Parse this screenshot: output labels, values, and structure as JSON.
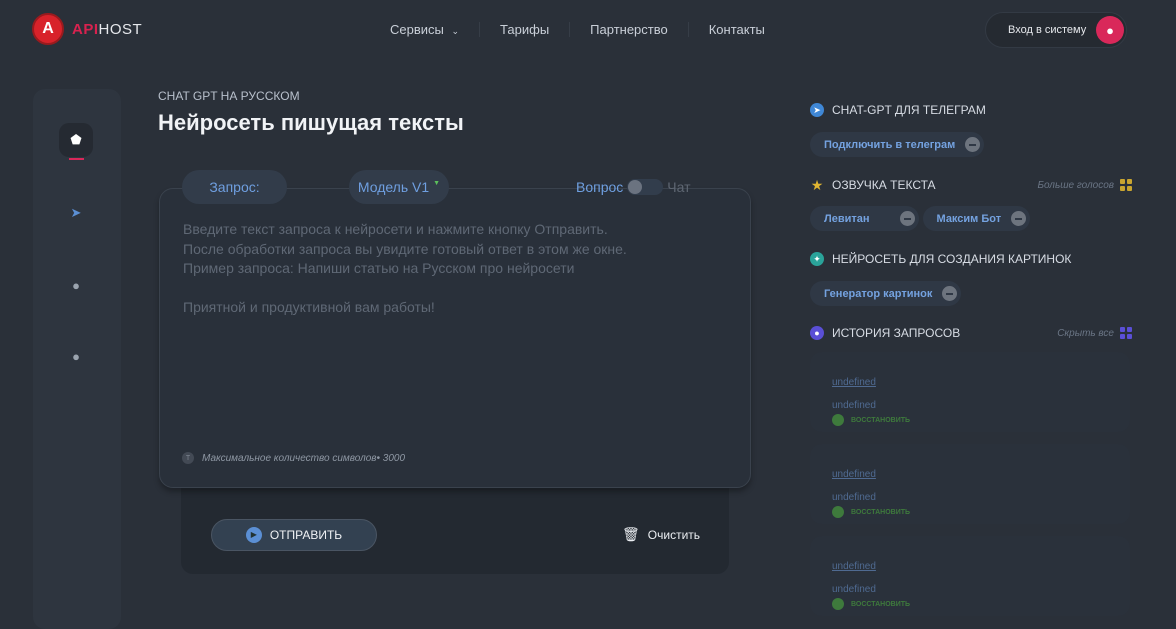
{
  "header": {
    "logo_api": "API",
    "logo_host": "HOST",
    "logo_letter": "A",
    "nav": [
      "Сервисы",
      "Тарифы",
      "Партнерство",
      "Контакты"
    ],
    "login": "Вход в систему"
  },
  "main": {
    "subtitle": "CHAT GPT НА РУССКОМ",
    "title": "Нейросеть пишущая тексты",
    "tab_request": "Запрос:",
    "tab_model": "Модель V1",
    "toggle_left": "Вопрос",
    "toggle_right": "Чат",
    "placeholder": [
      "Введите текст запроса к нейросети и нажмите кнопку Отправить.",
      "После обработки запроса вы увидите готовый ответ в этом же окне.",
      "Пример запроса: Напиши статью на Русском про нейросети",
      "",
      "Приятной и продуктивной вам работы!"
    ],
    "max_chars": "Максимальное количество символов• 3000",
    "send": "ОТПРАВИТЬ",
    "clear": "Очистить"
  },
  "right": {
    "telegram": {
      "title": "CHAT-GPT ДЛЯ ТЕЛЕГРАМ",
      "chip": "Подключить в телеграм"
    },
    "voice": {
      "title": "ОЗВУЧКА ТЕКСТА",
      "more": "Больше голосов",
      "chips": [
        "Левитан",
        "Максим Бот"
      ]
    },
    "images": {
      "title": "НЕЙРОСЕТЬ ДЛЯ СОЗДАНИЯ КАРТИНОК",
      "chip": "Генератор картинок"
    },
    "history": {
      "title": "ИСТОРИЯ ЗАПРОСОВ",
      "hide": "Скрыть все",
      "items": [
        {
          "q": "undefined",
          "a": "undefined",
          "restore": "ВОССТАНОВИТЬ"
        },
        {
          "q": "undefined",
          "a": "undefined",
          "restore": "ВОССТАНОВИТЬ"
        },
        {
          "q": "undefined",
          "a": "undefined",
          "restore": "ВОССТАНОВИТЬ"
        }
      ]
    }
  },
  "colors": {
    "accent": "#d9285a",
    "link": "#6f9fe0",
    "bg": "#2a3039"
  }
}
